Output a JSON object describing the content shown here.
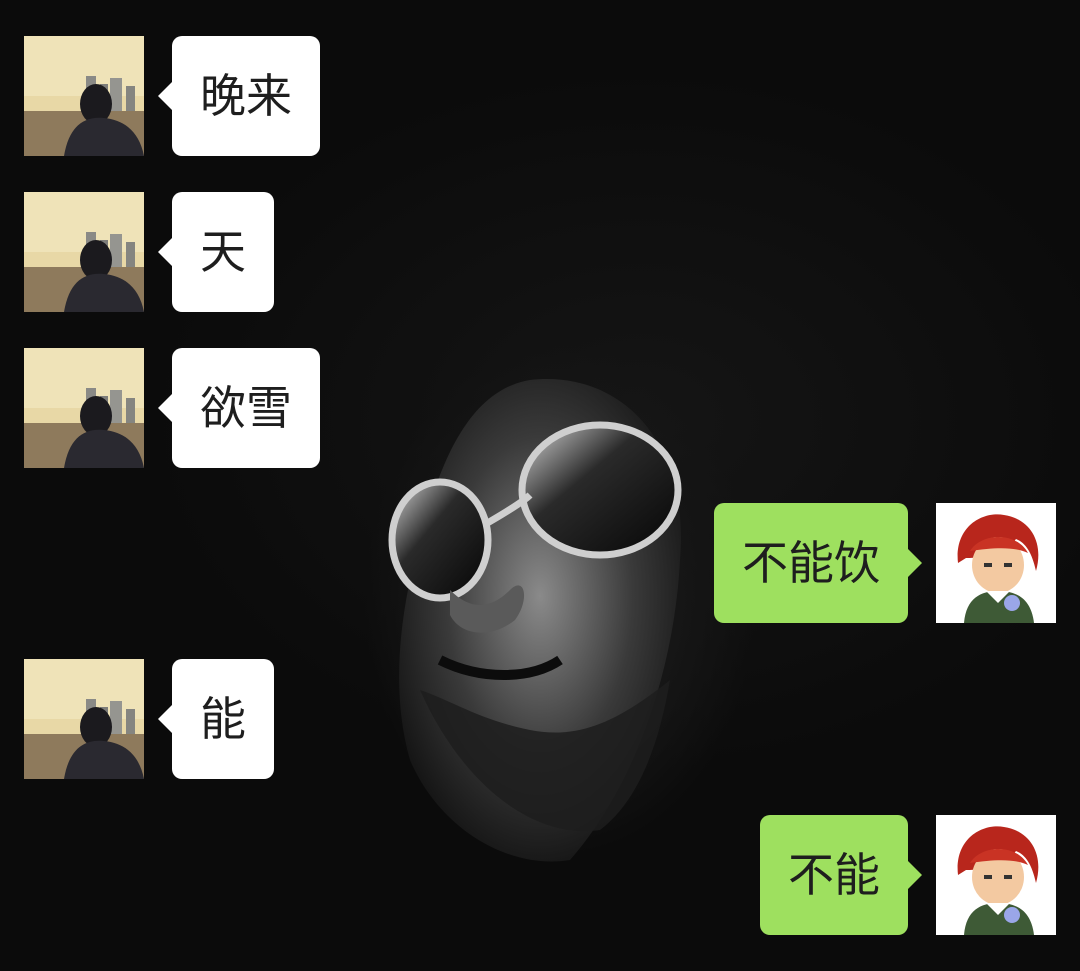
{
  "chat": {
    "messages": [
      {
        "side": "left",
        "text": "晚来",
        "avatar": "contact-avatar"
      },
      {
        "side": "left",
        "text": "天",
        "avatar": "contact-avatar"
      },
      {
        "side": "left",
        "text": "欲雪",
        "avatar": "contact-avatar"
      },
      {
        "side": "right",
        "text": "不能饮",
        "avatar": "self-avatar"
      },
      {
        "side": "left",
        "text": "能",
        "avatar": "contact-avatar"
      },
      {
        "side": "right",
        "text": "不能",
        "avatar": "self-avatar"
      }
    ]
  },
  "colors": {
    "background": "#0b0b0b",
    "incoming_bubble": "#ffffff",
    "outgoing_bubble": "#9ee05f",
    "text": "#1e1e1e"
  }
}
